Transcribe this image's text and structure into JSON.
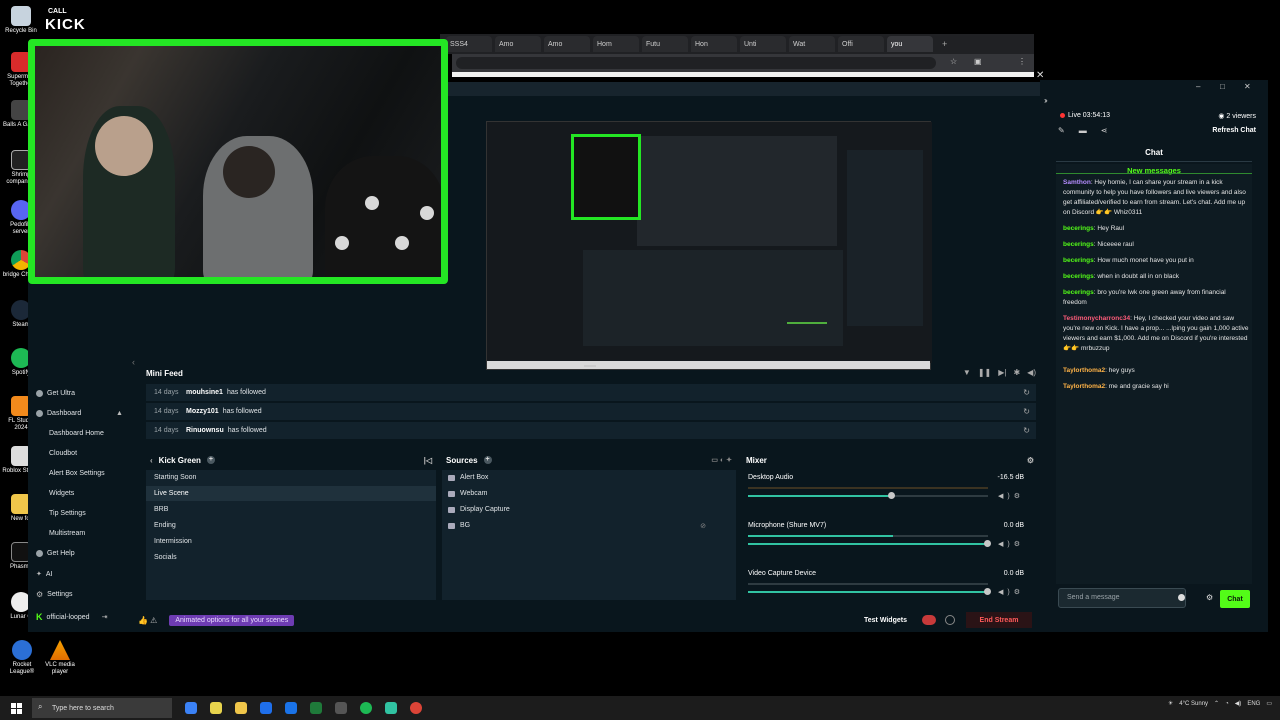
{
  "desktop": {
    "icons": [
      {
        "label": "Recycle Bin"
      },
      {
        "label": "Superman Together"
      },
      {
        "label": "Balls A Game"
      },
      {
        "label": "Shrimp companion"
      },
      {
        "label": "Pedofile server"
      },
      {
        "label": "bridge Chrom"
      },
      {
        "label": "Steam"
      },
      {
        "label": "Spotify"
      },
      {
        "label": "FL Studio 2024"
      },
      {
        "label": "Roblox Studio"
      },
      {
        "label": "New fol"
      },
      {
        "label": "Phasmo"
      },
      {
        "label": "Lunar C"
      },
      {
        "label": "Rocket League®"
      },
      {
        "label": "VLC media player"
      }
    ],
    "overlay_logo": {
      "line1": "CALL",
      "line2": "KICK"
    }
  },
  "browser": {
    "tabs": [
      "SSS4",
      "Amo",
      "Amo",
      "Hom",
      "Futu",
      "Hon",
      "Unti",
      "Wat",
      "Offi",
      "you"
    ]
  },
  "streamlabs": {
    "sidebar": {
      "get_ultra": "Get Ultra",
      "dashboard": "Dashboard",
      "items": [
        "Dashboard Home",
        "Cloudbot",
        "Alert Box Settings",
        "Widgets",
        "Tip Settings",
        "Multistream"
      ],
      "get_help": "Get Help",
      "ai": "AI",
      "settings": "Settings",
      "account": "official-looped"
    },
    "minifeed": {
      "title": "Mini Feed",
      "rows": [
        {
          "days": "14 days",
          "user": "mouhsine1",
          "action": "has followed"
        },
        {
          "days": "14 days",
          "user": "Mozzy101",
          "action": "has followed"
        },
        {
          "days": "14 days",
          "user": "Rinuownsu",
          "action": "has followed"
        }
      ]
    },
    "scenes": {
      "title": "Kick Green",
      "items": [
        "Starting Soon",
        "Live Scene",
        "BRB",
        "Ending",
        "Intermission",
        "Socials"
      ]
    },
    "sources": {
      "title": "Sources",
      "items": [
        "Alert Box",
        "Webcam",
        "Display Capture",
        "BG"
      ]
    },
    "mixer": {
      "title": "Mixer",
      "channels": [
        {
          "name": "Desktop Audio",
          "db": "-16.5 dB",
          "level": 0.6
        },
        {
          "name": "Microphone (Shure MV7)",
          "db": "0.0 dB",
          "level": 1.0
        },
        {
          "name": "Video Capture Device",
          "db": "0.0 dB",
          "level": 1.0
        }
      ]
    },
    "footer": {
      "banner": "Animated options for all your scenes",
      "test_widgets": "Test Widgets",
      "end_stream": "End Stream"
    }
  },
  "chat": {
    "live": "Live 03:54:13",
    "viewers": "2 viewers",
    "refresh": "Refresh Chat",
    "title": "Chat",
    "new_messages": "New messages",
    "messages": [
      {
        "user": "Samthon",
        "color": "#b58cff",
        "text": ": Hey homie, I can share your stream in a kick community to help you have followers and live viewers and also get affiliated/verified to earn from stream. Let's chat. Add me up on Discord 👉👉 Whiz0311"
      },
      {
        "user": "becerings",
        "color": "#53fc18",
        "text": ": Hey Raul"
      },
      {
        "user": "becerings",
        "color": "#53fc18",
        "text": ": Niceeee raul"
      },
      {
        "user": "becerings",
        "color": "#53fc18",
        "text": ": How much monet have you put in"
      },
      {
        "user": "becerings",
        "color": "#53fc18",
        "text": ": when in doubt all in on black"
      },
      {
        "user": "becerings",
        "color": "#53fc18",
        "text": ": bro you're lwk one green away from financial freedom"
      },
      {
        "user": "Testimonycharronc34",
        "color": "#ff5c7a",
        "text": ": Hey, I checked your video and saw you're new on Kick. I have a prop... ...lping you gain 1,000 active viewers and earn $1,000. Add me on Discord if you're interested 👉👉 mrbuzzup"
      },
      {
        "user": "Taylorthoma2",
        "color": "#ffb347",
        "text": ": hey guys"
      },
      {
        "user": "Taylorthoma2",
        "color": "#ffb347",
        "text": ": me and gracie say hi"
      }
    ],
    "input_placeholder": "Send a message",
    "send_label": "Chat"
  },
  "taskbar": {
    "search_placeholder": "Type here to search",
    "weather": "4°C Sunny",
    "lang": "ENG"
  },
  "colors": {
    "kick_green": "#53fc18",
    "webcam_border": "#24e624",
    "end_stream": "#ff5a5a"
  }
}
